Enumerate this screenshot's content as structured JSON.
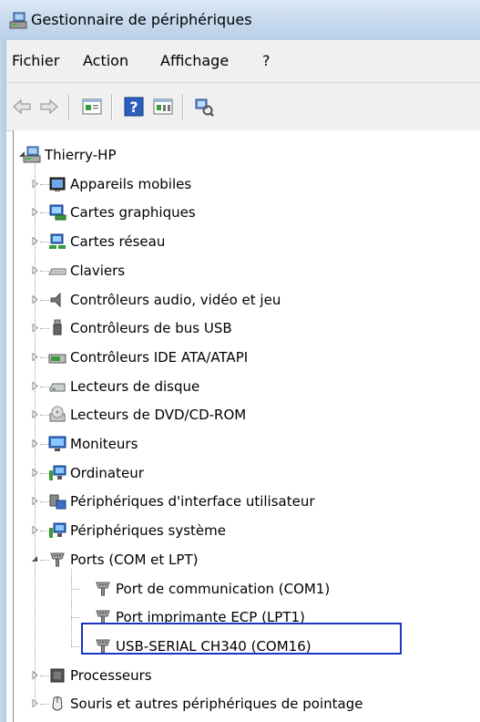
{
  "window": {
    "title": "Gestionnaire de périphériques"
  },
  "menu": [
    "Fichier",
    "Action",
    "Affichage",
    "?"
  ],
  "toolbar": {
    "buttons": [
      {
        "name": "back-button",
        "icon": "back-arrow-icon"
      },
      {
        "name": "forward-button",
        "icon": "forward-arrow-icon"
      },
      {
        "name": "properties-button",
        "icon": "properties-icon"
      },
      {
        "name": "help-button",
        "icon": "help-icon"
      },
      {
        "name": "view-button",
        "icon": "view-icon"
      },
      {
        "name": "scan-hardware-button",
        "icon": "scan-hardware-icon"
      }
    ]
  },
  "tree": {
    "root": {
      "label": "Thierry-HP",
      "icon": "computer-icon",
      "expanded": true
    },
    "categories": [
      {
        "label": "Appareils mobiles",
        "icon": "mobile-device-icon",
        "expanded": false
      },
      {
        "label": "Cartes graphiques",
        "icon": "display-adapter-icon",
        "expanded": false
      },
      {
        "label": "Cartes réseau",
        "icon": "network-adapter-icon",
        "expanded": false
      },
      {
        "label": "Claviers",
        "icon": "keyboard-icon",
        "expanded": false
      },
      {
        "label": "Contrôleurs audio, vidéo et jeu",
        "icon": "audio-icon",
        "expanded": false
      },
      {
        "label": "Contrôleurs de bus USB",
        "icon": "usb-icon",
        "expanded": false
      },
      {
        "label": "Contrôleurs IDE ATA/ATAPI",
        "icon": "ide-controller-icon",
        "expanded": false
      },
      {
        "label": "Lecteurs de disque",
        "icon": "disk-drive-icon",
        "expanded": false
      },
      {
        "label": "Lecteurs de DVD/CD-ROM",
        "icon": "dvd-drive-icon",
        "expanded": false
      },
      {
        "label": "Moniteurs",
        "icon": "monitor-icon",
        "expanded": false
      },
      {
        "label": "Ordinateur",
        "icon": "computer-small-icon",
        "expanded": false
      },
      {
        "label": "Périphériques d'interface utilisateur",
        "icon": "hid-icon",
        "expanded": false
      },
      {
        "label": "Périphériques système",
        "icon": "system-device-icon",
        "expanded": false
      },
      {
        "label": "Ports (COM et LPT)",
        "icon": "port-icon",
        "expanded": true,
        "children": [
          {
            "label": "Port de communication (COM1)",
            "icon": "port-icon"
          },
          {
            "label": "Port imprimante ECP (LPT1)",
            "icon": "port-icon"
          },
          {
            "label": "USB-SERIAL CH340 (COM16)",
            "icon": "port-icon",
            "highlighted": true
          }
        ]
      },
      {
        "label": "Processeurs",
        "icon": "processor-icon",
        "expanded": false
      },
      {
        "label": "Souris et autres périphériques de pointage",
        "icon": "mouse-icon",
        "expanded": false
      }
    ]
  },
  "colors": {
    "highlight_border": "#1a33c0"
  }
}
